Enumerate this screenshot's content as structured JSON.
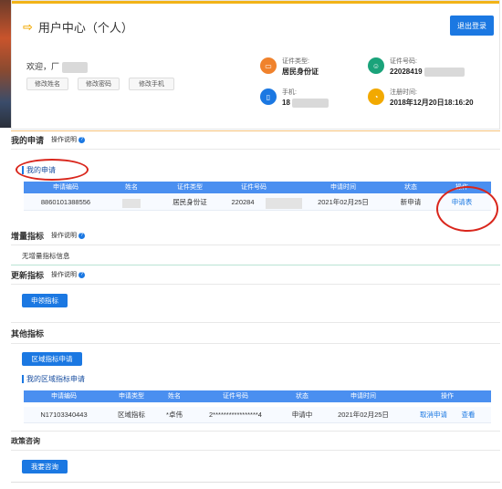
{
  "header": {
    "title": "用户中心（个人）",
    "logout_label": "退出登录",
    "welcome_prefix": "欢迎，",
    "welcome_name": "厂",
    "buttons": [
      "修改姓名",
      "修改密码",
      "修改手机"
    ],
    "info": [
      {
        "label": "证件类型:",
        "value": "居民身份证",
        "icon": "id-card-icon",
        "color": "#f0822c"
      },
      {
        "label": "证件号码:",
        "value": "22028419",
        "icon": "id-number-icon",
        "color": "#1aa37a"
      },
      {
        "label": "手机:",
        "value": "18",
        "icon": "phone-icon",
        "color": "#1b78e2"
      },
      {
        "label": "注册时间:",
        "value": "2018年12月20日18:16:20",
        "icon": "clock-icon",
        "color": "#f2a900"
      }
    ]
  },
  "my_apply": {
    "title": "我的申请",
    "help": "操作说明",
    "subtitle": "我的申请",
    "columns": [
      "申请编码",
      "姓名",
      "证件类型",
      "证件号码",
      "申请时间",
      "状态",
      "操作"
    ],
    "row": {
      "code": "8860101388556",
      "name": "",
      "id_type": "居民身份证",
      "id_no": "220284",
      "time": "2021年02月25日",
      "status": "新申请",
      "action": "申请表"
    }
  },
  "increase": {
    "title": "增量指标",
    "help": "操作说明",
    "empty": "无增量指标信息"
  },
  "update": {
    "title": "更新指标",
    "help": "操作说明",
    "button": "申领指标"
  },
  "other": {
    "title": "其他指标",
    "button": "区域指标申请",
    "subtitle": "我的区域指标申请",
    "columns": [
      "申请编码",
      "申请类型",
      "姓名",
      "证件号码",
      "状态",
      "申请时间",
      "操作"
    ],
    "row": {
      "code": "N17103340443",
      "type": "区域指标",
      "name": "*卓伟",
      "id_no": "2*****************4",
      "status": "申请中",
      "time": "2021年02月25日",
      "cancel": "取消申请",
      "view": "查看"
    }
  },
  "policy": {
    "title": "政策咨询",
    "button": "我要咨询"
  }
}
